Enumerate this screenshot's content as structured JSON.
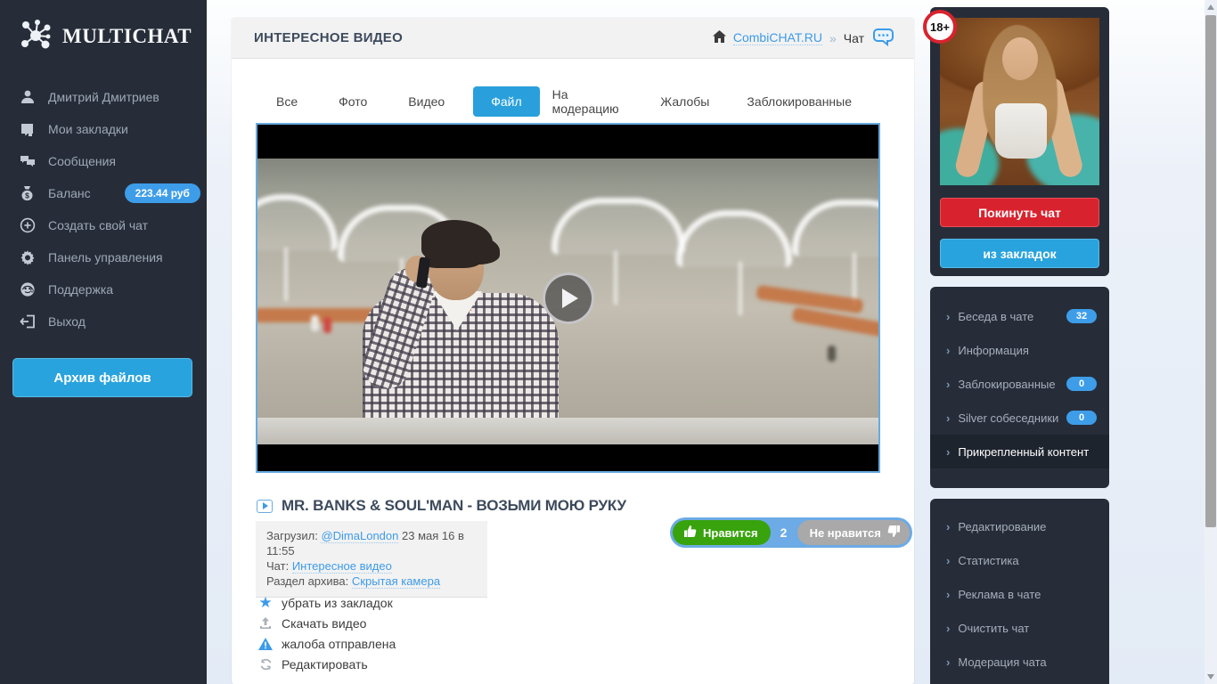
{
  "brand": {
    "name": "MULTICHAT"
  },
  "colors": {
    "sidebar_dark": "#262d39",
    "accent_blue": "#29a3dd",
    "link_blue": "#3d9be9",
    "like_green": "#38a30d",
    "dislike_gray": "#a9a9a9",
    "leave_red": "#d8232f"
  },
  "sidebar": {
    "items": [
      {
        "label": "Дмитрий Дмитриев",
        "icon": "user-icon"
      },
      {
        "label": "Мои закладки",
        "icon": "bookmark-icon"
      },
      {
        "label": "Сообщения",
        "icon": "messages-icon"
      },
      {
        "label": "Баланс",
        "icon": "money-bag-icon",
        "badge": "223.44 руб"
      },
      {
        "label": "Создать свой чат",
        "icon": "plus-circle-icon"
      },
      {
        "label": "Панель управления",
        "icon": "gear-icon"
      },
      {
        "label": "Поддержка",
        "icon": "support-icon"
      },
      {
        "label": "Выход",
        "icon": "logout-icon"
      }
    ],
    "archive_button": "Архив файлов"
  },
  "header": {
    "title": "ИНТЕРЕСНОЕ ВИДЕО",
    "breadcrumb": {
      "site": "CombiCHAT.RU",
      "separator": "»",
      "current": "Чат"
    }
  },
  "tabs": {
    "left": [
      "Все",
      "Фото",
      "Видео",
      "Файл"
    ],
    "active": "Файл",
    "right": [
      "На модерацию",
      "Жалобы",
      "Заблокированные"
    ]
  },
  "video": {
    "title": "MR. BANKS & SOUL'MAN - ВОЗЬМИ МОЮ РУКУ",
    "info": {
      "uploaded_label": "Загрузил:",
      "uploader": "@DimaLondon",
      "uploaded_date": "23 мая 16 в 11:55",
      "chat_label": "Чат:",
      "chat": "Интересное видео",
      "section_label": "Раздел архива:",
      "section": "Скрытая камера"
    },
    "likes": {
      "like_label": "Нравится",
      "count": "2",
      "dislike_label": "Не нравится"
    },
    "actions": [
      {
        "label": "убрать из закладок",
        "icon": "star-icon"
      },
      {
        "label": "Скачать видео",
        "icon": "download-icon"
      },
      {
        "label": "жалоба отправлена",
        "icon": "warning-icon"
      },
      {
        "label": "Редактировать",
        "icon": "edit-icon"
      }
    ]
  },
  "right_panel": {
    "age_badge": "18+",
    "leave_button": "Покинуть чат",
    "bookmarks_button": "из закладок",
    "menu1": [
      {
        "label": "Беседа в чате",
        "badge": "32"
      },
      {
        "label": "Информация"
      },
      {
        "label": "Заблокированные",
        "badge": "0"
      },
      {
        "label": "Silver собеседники",
        "badge": "0"
      },
      {
        "label": "Прикрепленный контент",
        "active": true
      }
    ],
    "menu2": [
      {
        "label": "Редактирование"
      },
      {
        "label": "Статистика"
      },
      {
        "label": "Реклама в чате"
      },
      {
        "label": "Очистить чат"
      },
      {
        "label": "Модерация чата"
      }
    ]
  }
}
